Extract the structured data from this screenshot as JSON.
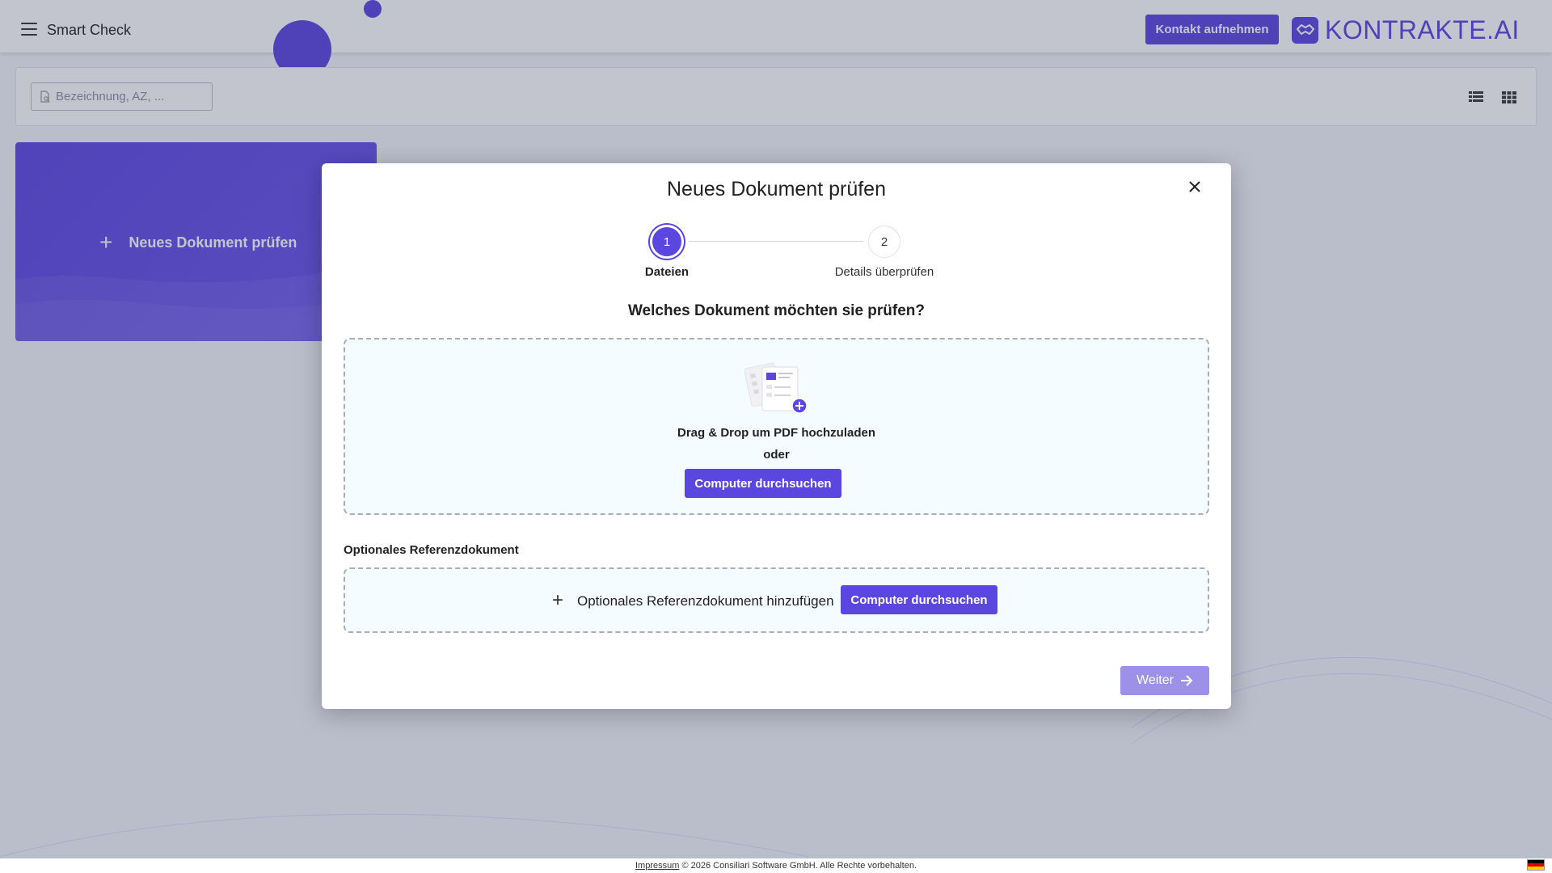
{
  "app": {
    "title": "Smart Check",
    "contact_label": "Kontakt aufnehmen",
    "logo_text": "KONTRAKTE.AI",
    "accent_color": "#5b46e0"
  },
  "search": {
    "placeholder": "Bezeichnung, AZ, ..."
  },
  "card": {
    "label": "Neues Dokument prüfen"
  },
  "modal": {
    "title": "Neues Dokument prüfen",
    "steps": [
      {
        "number": "1",
        "label": "Dateien"
      },
      {
        "number": "2",
        "label": "Details überprüfen"
      }
    ],
    "question": "Welches Dokument möchten sie prüfen?",
    "dropzone": {
      "text": "Drag & Drop um PDF hochzuladen",
      "or": "oder",
      "browse_label": "Computer durchsuchen"
    },
    "reference": {
      "heading": "Optionales Referenzdokument",
      "add_label": "Optionales Referenzdokument hinzufügen",
      "browse_label": "Computer durchsuchen"
    },
    "next_label": "Weiter"
  },
  "footer": {
    "impressum": "Impressum",
    "copyright": "© 2026 Consiliari Software GmbH. Alle Rechte vorbehalten."
  }
}
